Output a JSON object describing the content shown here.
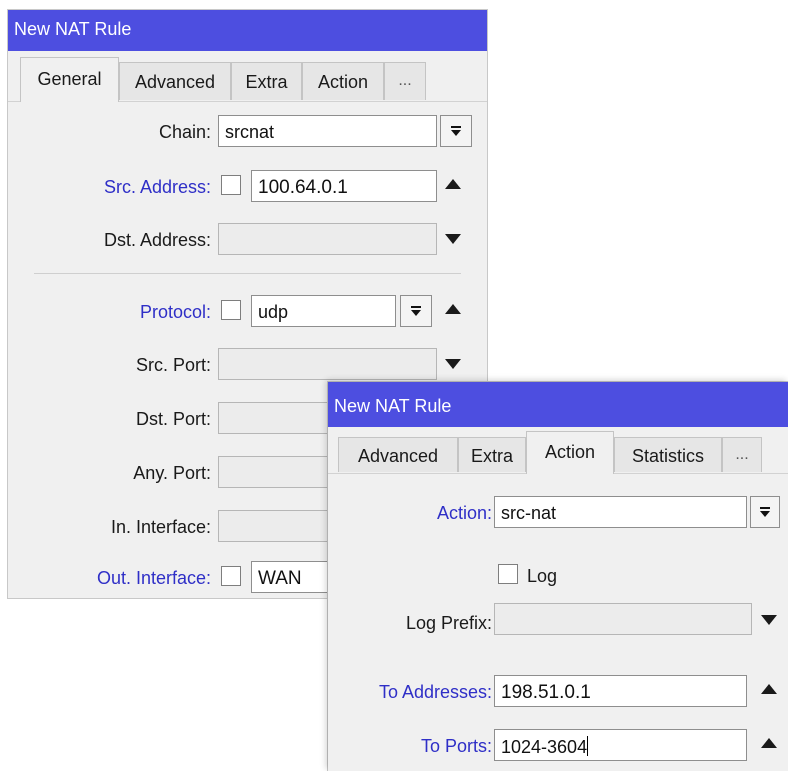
{
  "window1": {
    "title": "New NAT Rule",
    "tabs": [
      "General",
      "Advanced",
      "Extra",
      "Action",
      "..."
    ],
    "fields": {
      "chain": {
        "label": "Chain:",
        "value": "srcnat"
      },
      "src_address": {
        "label": "Src. Address:",
        "value": "100.64.0.1"
      },
      "dst_address": {
        "label": "Dst. Address:",
        "value": ""
      },
      "protocol": {
        "label": "Protocol:",
        "value": "udp"
      },
      "src_port": {
        "label": "Src. Port:",
        "value": ""
      },
      "dst_port": {
        "label": "Dst. Port:",
        "value": ""
      },
      "any_port": {
        "label": "Any. Port:",
        "value": ""
      },
      "in_interface": {
        "label": "In. Interface:",
        "value": ""
      },
      "out_interface": {
        "label": "Out. Interface:",
        "value": "WAN"
      }
    }
  },
  "window2": {
    "title": "New NAT Rule",
    "tabs": [
      "Advanced",
      "Extra",
      "Action",
      "Statistics",
      "..."
    ],
    "fields": {
      "action": {
        "label": "Action:",
        "value": "src-nat"
      },
      "log": {
        "label": "Log"
      },
      "log_prefix": {
        "label": "Log Prefix:",
        "value": ""
      },
      "to_addresses": {
        "label": "To Addresses:",
        "value": "198.51.0.1"
      },
      "to_ports": {
        "label": "To Ports:",
        "value": "1024-3604"
      }
    }
  },
  "colors": {
    "titlebar": "#4d4ee0",
    "label_link": "#2f2fc7",
    "window_bg": "#f0f0f0"
  },
  "icons": {
    "dropdown": "dropdown-arrow-icon",
    "expand": "triangle-up-icon",
    "collapse": "triangle-down-icon"
  }
}
